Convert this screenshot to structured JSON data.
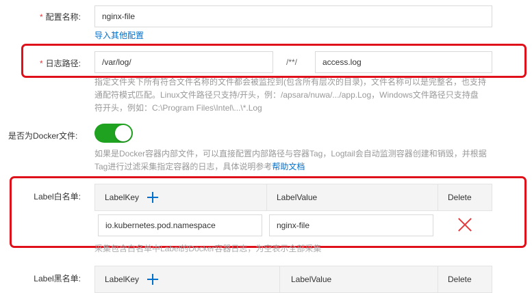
{
  "config_name": {
    "label": "配置名称:",
    "value": "nginx-file",
    "import_link": "导入其他配置"
  },
  "log_path": {
    "label": "日志路径:",
    "dir_value": "/var/log/",
    "separator": "/**/",
    "file_value": "access.log",
    "help": [
      "指定文件夹下所有符合文件名称的文件都会被监控到(包含所有层次的目录)，文件名称可以是完整名，也支持",
      "通配符模式匹配。Linux文件路径只支持/开头，例：/apsara/nuwa/.../app.Log，Windows文件路径只支持盘",
      "符开头，例如：C:\\Program Files\\Intel\\...\\*.Log"
    ]
  },
  "docker": {
    "label": "是否为Docker文件:",
    "enabled": true,
    "help_line1": "如果是Docker容器内部文件，可以直接配置内部路径与容器Tag，Logtail会自动监测容器创建和销毁，并根据",
    "help_line2": "Tag进行过滤采集指定容器的日志，具体说明参考",
    "help_link": "帮助文档"
  },
  "label_whitelist": {
    "label": "Label白名单:",
    "headers": {
      "key": "LabelKey",
      "value": "LabelValue",
      "delete": "Delete"
    },
    "rows": [
      {
        "key": "io.kubernetes.pod.namespace",
        "value": "nginx-file"
      }
    ],
    "help": "采集包含白名单中Label的Docker容器日志，为空表示全部采集"
  },
  "label_blacklist": {
    "label": "Label黑名单:",
    "headers": {
      "key": "LabelKey",
      "value": "LabelValue",
      "delete": "Delete"
    }
  },
  "colors": {
    "accent": "#0070cc",
    "toggle_on": "#1fa21f",
    "highlight_box": "#e0101a",
    "delete_icon": "#e4393c"
  }
}
